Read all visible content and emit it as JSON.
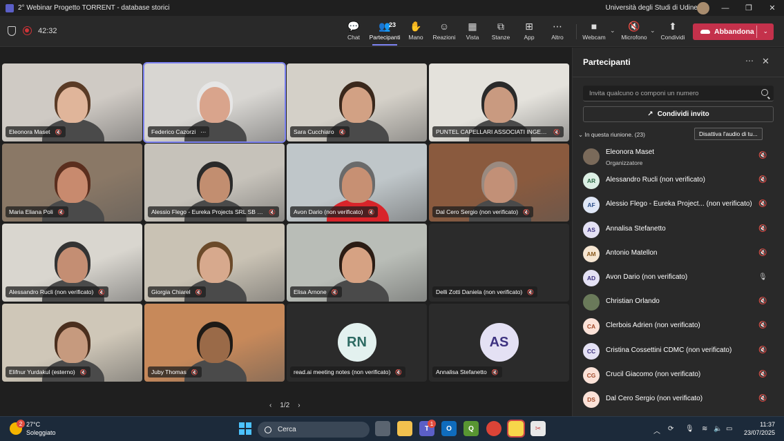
{
  "window": {
    "title": "2° Webinar Progetto TORRENT - database storici",
    "organization": "Università degli Studi di Udine"
  },
  "toolbar": {
    "timer": "42:32",
    "items": [
      {
        "label": "Chat",
        "icon": "chat-icon"
      },
      {
        "label": "Partecipanti",
        "icon": "people-icon",
        "badge": "23"
      },
      {
        "label": "Mano",
        "icon": "hand-icon"
      },
      {
        "label": "Reazioni",
        "icon": "smile-icon"
      },
      {
        "label": "Vista",
        "icon": "grid-icon"
      },
      {
        "label": "Stanze",
        "icon": "rooms-icon"
      },
      {
        "label": "App",
        "icon": "add-icon"
      },
      {
        "label": "Altro",
        "icon": "more-icon"
      }
    ],
    "webcam_label": "Webcam",
    "microphone_label": "Microfono",
    "share_label": "Condividi",
    "leave_label": "Abbandona"
  },
  "grid": {
    "tiles": [
      {
        "name": "Eleonora Maset",
        "kind": "video",
        "bg": "#cfcac4",
        "skin": "#e0b59a",
        "hair": "#5a3b26"
      },
      {
        "name": "Federico Cazorzi",
        "kind": "video",
        "bg": "#d8d6d2",
        "skin": "#d9a48c",
        "hair": "#e6e6e6",
        "speaking": true,
        "more": true
      },
      {
        "name": "Sara Cucchiaro",
        "kind": "video",
        "bg": "#d4d0c8",
        "skin": "#d2a184",
        "hair": "#3a281c"
      },
      {
        "name": "PUNTEL CAPELLARI ASSOCIATI INGEGN...",
        "kind": "video",
        "bg": "#e4e2dc",
        "skin": "#c99a80",
        "hair": "#2a2a2a"
      },
      {
        "name": "Maria Eliana Poli",
        "kind": "video",
        "bg": "#8a7866",
        "skin": "#c88a6e",
        "hair": "#5a2e1e"
      },
      {
        "name": "Alessio Flego - Eureka Projects SRL SB (...",
        "kind": "video",
        "bg": "#c6c2ba",
        "skin": "#c28e70",
        "hair": "#2a2a2a"
      },
      {
        "name": "Avon Dario (non verificato)",
        "kind": "video",
        "bg": "#bfc6c9",
        "skin": "#c79073",
        "hair": "#6a6a6a",
        "shirt": "#d8242a"
      },
      {
        "name": "Dal Cero Sergio (non verificato)",
        "kind": "video",
        "bg": "#8a5a3e",
        "skin": "#c29077",
        "hair": "#9a8a80"
      },
      {
        "name": "Alessandro Rucli (non verificato)",
        "kind": "video",
        "bg": "#d9d6cf",
        "skin": "#c48e73",
        "hair": "#333333"
      },
      {
        "name": "Giorgia Chiarel",
        "kind": "video",
        "bg": "#c9c2b4",
        "skin": "#d7a98d",
        "hair": "#6b4a2a"
      },
      {
        "name": "Elisa Arnone",
        "kind": "video",
        "bg": "#b9bdb7",
        "skin": "#d6a283",
        "hair": "#2b1c14"
      },
      {
        "name": "Delli Zotti Daniela (non verificato)",
        "kind": "blank"
      },
      {
        "name": "Elifnur Yurdakul (esterno)",
        "kind": "video",
        "bg": "#cfc7b8",
        "skin": "#c69a7e",
        "hair": "#4a2f1e"
      },
      {
        "name": "Juby Thomas",
        "kind": "video",
        "bg": "#c7895a",
        "skin": "#9a6a48",
        "hair": "#1e1a16"
      },
      {
        "name": "read.ai meeting notes (non verificato)",
        "kind": "avatar",
        "initials": "RN",
        "avatar_bg": "#e3f1ef",
        "avatar_fg": "#2d6a62"
      },
      {
        "name": "Annalisa Stefanetto",
        "kind": "avatar",
        "initials": "AS",
        "avatar_bg": "#e4e1f4",
        "avatar_fg": "#3d3280"
      }
    ],
    "pager": "1/2"
  },
  "panel": {
    "title": "Partecipanti",
    "search_placeholder": "Invita qualcuno o componi un numero",
    "share_invite_label": "Condividi invito",
    "in_meeting_label": "In questa riunione. (23)",
    "mute_all_label": "Disattiva l'audio di tu...",
    "participants": [
      {
        "name": "Eleonora Maset",
        "role": "Organizzatore",
        "initials": "",
        "photo": true,
        "av_bg": "#7a6a5a",
        "av_fg": "#ffffff",
        "mic": "muted"
      },
      {
        "name": "Alessandro Rucli (non verificato)",
        "initials": "AR",
        "av_bg": "#dcefe4",
        "av_fg": "#2e6b47",
        "mic": "muted"
      },
      {
        "name": "Alessio Flego - Eureka Project...  (non verificato)",
        "initials": "AF",
        "av_bg": "#dfe7f6",
        "av_fg": "#2c4f8a",
        "mic": "muted"
      },
      {
        "name": "Annalisa Stefanetto",
        "initials": "AS",
        "av_bg": "#e4e1f4",
        "av_fg": "#3d3280",
        "mic": "muted"
      },
      {
        "name": "Antonio Matellon",
        "initials": "AM",
        "av_bg": "#f6e6d2",
        "av_fg": "#8a5a1e",
        "mic": "muted"
      },
      {
        "name": "Avon Dario (non verificato)",
        "initials": "AD",
        "av_bg": "#e4e1f4",
        "av_fg": "#3d3280",
        "mic": "on"
      },
      {
        "name": "Christian Orlando",
        "initials": "",
        "photo": true,
        "av_bg": "#6a7a5a",
        "av_fg": "#ffffff",
        "mic": "muted"
      },
      {
        "name": "Clerbois Adrien (non verificato)",
        "initials": "CA",
        "av_bg": "#fbe2d8",
        "av_fg": "#a24a2a",
        "mic": "muted"
      },
      {
        "name": "Cristina Cossettini CDMC (non verificato)",
        "initials": "CC",
        "av_bg": "#e4e1f4",
        "av_fg": "#3d3280",
        "mic": "muted"
      },
      {
        "name": "Crucil Giacomo (non verificato)",
        "initials": "CG",
        "av_bg": "#fbe2d8",
        "av_fg": "#a24a2a",
        "mic": "muted"
      },
      {
        "name": "Dal Cero Sergio (non verificato)",
        "initials": "DS",
        "av_bg": "#fbe2d8",
        "av_fg": "#a24a2a",
        "mic": "muted"
      }
    ]
  },
  "taskbar": {
    "temperature": "27°C",
    "weather": "Soleggiato",
    "weather_badge": "2",
    "search_label": "Cerca",
    "teams_badge": "1",
    "time": "11:37",
    "date": "23/07/2025"
  }
}
